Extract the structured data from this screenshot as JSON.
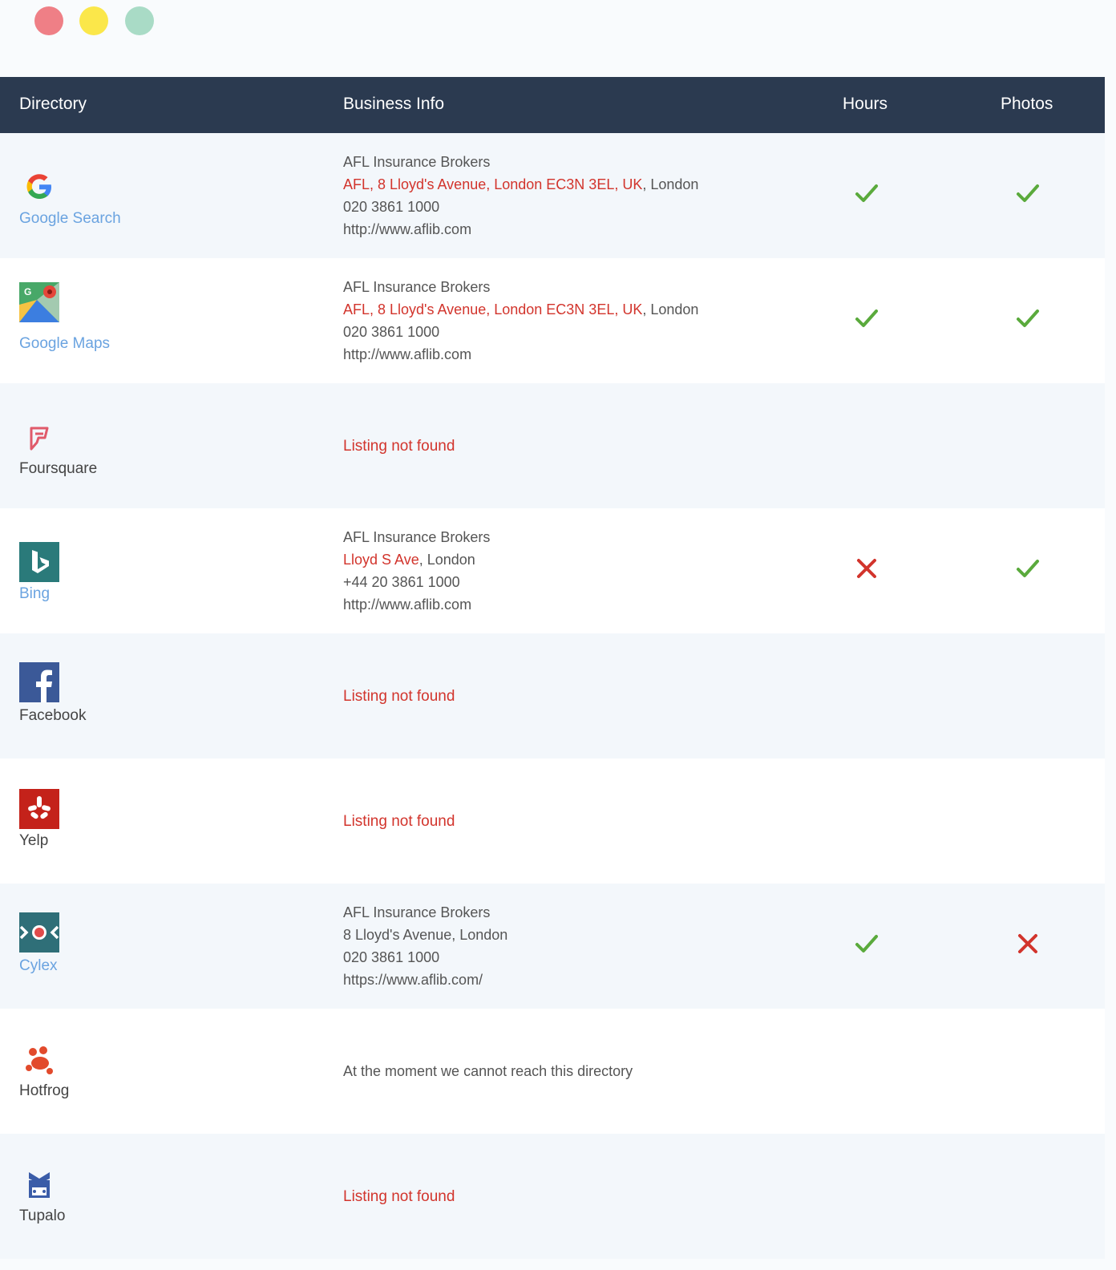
{
  "window": {
    "controls": [
      "close",
      "minimize",
      "maximize"
    ]
  },
  "table": {
    "headers": {
      "directory": "Directory",
      "info": "Business Info",
      "hours": "Hours",
      "photos": "Photos"
    }
  },
  "rows": [
    {
      "directory": "Google Search",
      "icon": "google-icon",
      "name": "AFL Insurance Brokers",
      "address": "AFL, 8 Lloyd's Avenue, London EC3N 3EL, UK",
      "city": ", London",
      "phone": "020 3861 1000",
      "website": "http://www.aflib.com",
      "hours": true,
      "photos": true
    },
    {
      "directory": "Google Maps",
      "icon": "google-maps-icon",
      "name": "AFL Insurance Brokers",
      "address": "AFL, 8 Lloyd's Avenue, London EC3N 3EL, UK",
      "city": ", London",
      "phone": "020 3861 1000",
      "website": "http://www.aflib.com",
      "hours": true,
      "photos": true
    },
    {
      "directory": "Foursquare",
      "icon": "foursquare-icon",
      "status": "Listing not found"
    },
    {
      "directory": "Bing",
      "icon": "bing-icon",
      "name": "AFL Insurance Brokers",
      "address": "Lloyd S Ave",
      "city": ", London",
      "phone": "+44 20 3861 1000",
      "website": "http://www.aflib.com",
      "hours": false,
      "photos": true
    },
    {
      "directory": "Facebook",
      "icon": "facebook-icon",
      "status": "Listing not found"
    },
    {
      "directory": "Yelp",
      "icon": "yelp-icon",
      "status": "Listing not found"
    },
    {
      "directory": "Cylex",
      "icon": "cylex-icon",
      "name": "AFL Insurance Brokers",
      "address": "",
      "city": "8 Lloyd's Avenue, London",
      "phone": "020 3861 1000",
      "website": "https://www.aflib.com/",
      "hours": true,
      "photos": false
    },
    {
      "directory": "Hotfrog",
      "icon": "hotfrog-icon",
      "status": "At the moment we cannot reach this directory"
    },
    {
      "directory": "Tupalo",
      "icon": "tupalo-icon",
      "status": "Listing not found"
    }
  ],
  "colors": {
    "header_bg": "#2b3a50",
    "check": "#5aaa3c",
    "cross": "#d2342c",
    "link": "#6aa3e0",
    "error": "#d2342c"
  }
}
